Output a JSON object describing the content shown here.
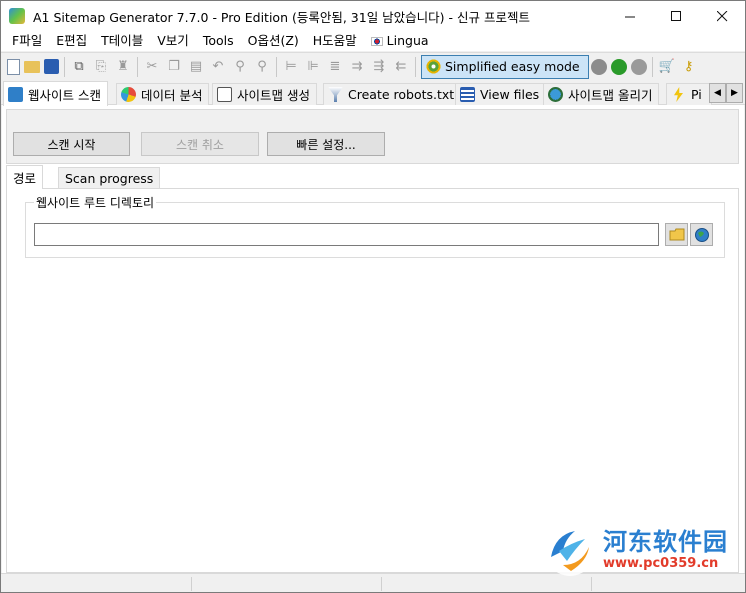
{
  "window": {
    "title": "A1 Sitemap Generator 7.7.0 - Pro Edition (등록안됨, 31일 남았습니다) - 신규 프로젝트",
    "controls": {
      "minimize": "—",
      "maximize": "☐",
      "close": "✕"
    }
  },
  "menu": {
    "items": [
      "F파일",
      "E편집",
      "T테이블",
      "V보기",
      "Tools",
      "O옵션(Z)",
      "H도움말",
      "Lingua"
    ]
  },
  "toolbar": {
    "simplified_mode_label": "Simplified easy mode"
  },
  "tabs": [
    {
      "label": "웹사이트 스캔",
      "icon": "scan-icon",
      "active": true
    },
    {
      "label": "데이터 분석",
      "icon": "chart-icon",
      "active": false
    },
    {
      "label": "사이트맵 생성",
      "icon": "sitemap-icon",
      "active": false
    },
    {
      "label": "Create robots.txt",
      "icon": "filter-icon",
      "active": false
    },
    {
      "label": "View files",
      "icon": "list-icon",
      "active": false
    },
    {
      "label": "사이트맵 올리기",
      "icon": "upload-icon",
      "active": false
    },
    {
      "label": "Pi",
      "icon": "lightning-icon",
      "active": false
    }
  ],
  "scan_buttons": {
    "start": "스캔 시작",
    "cancel": "스캔 취소",
    "quick_settings": "빠른 설정..."
  },
  "subtabs": [
    {
      "label": "경로",
      "active": true
    },
    {
      "label": "Scan progress",
      "active": false
    }
  ],
  "path_panel": {
    "group_label": "웹사이트 루트 디렉토리",
    "input_value": ""
  },
  "watermark": {
    "cn_text": "河东软件园",
    "url": "www.pc0359.cn"
  }
}
